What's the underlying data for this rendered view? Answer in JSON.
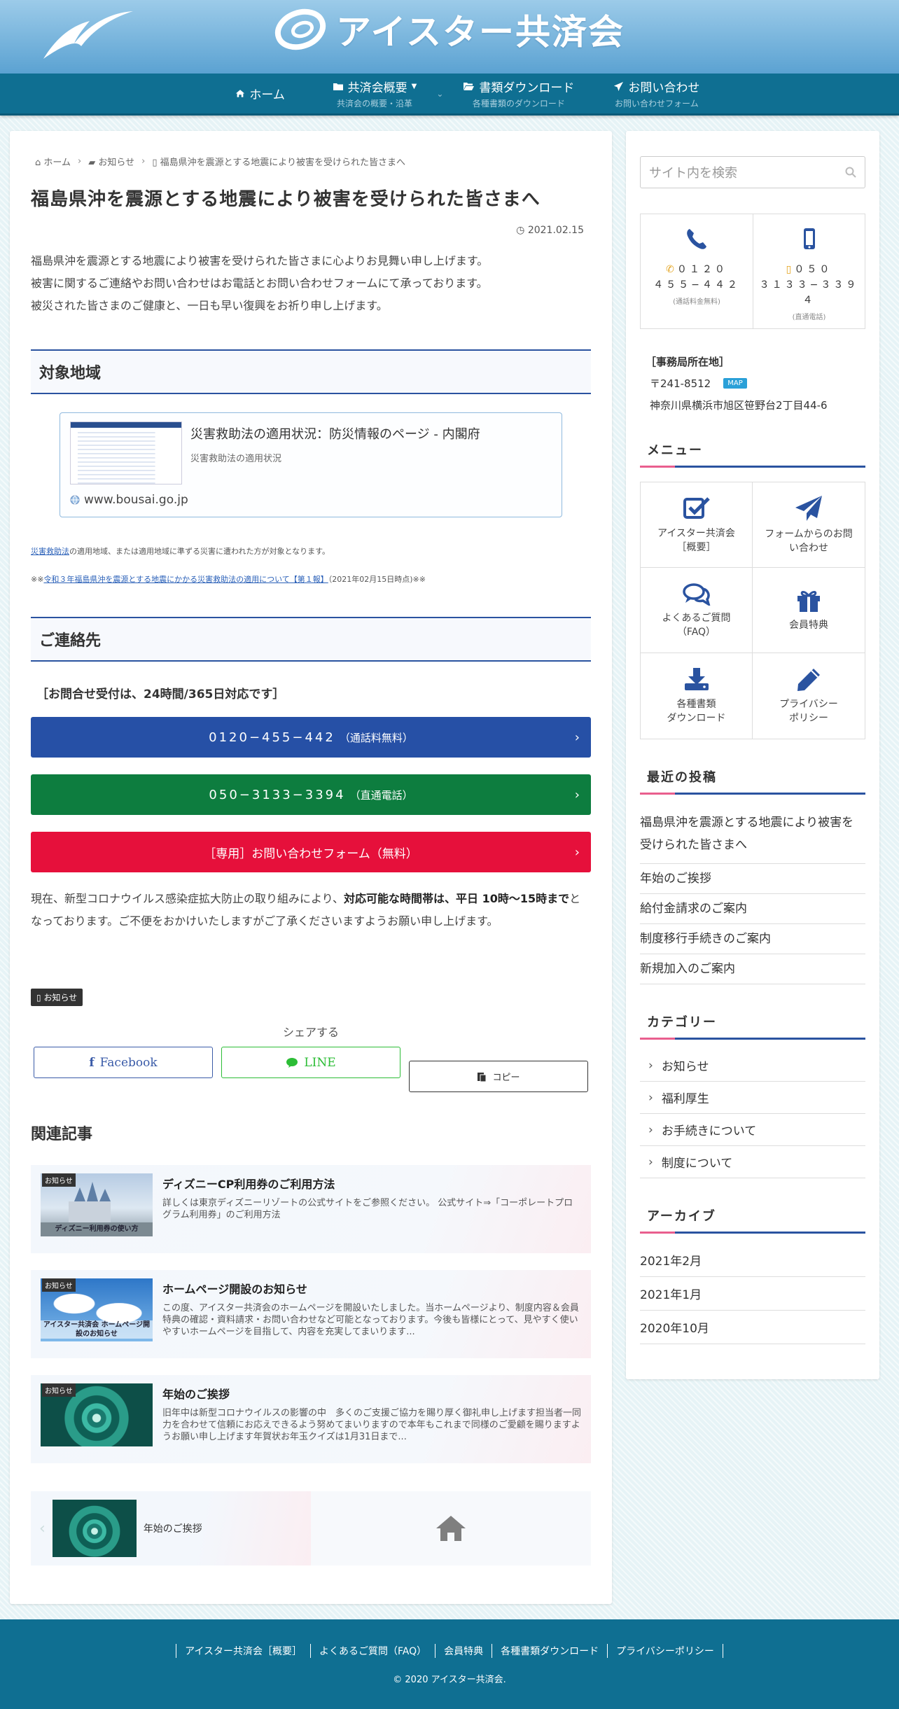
{
  "site": {
    "logo_text": "アイスター共済会"
  },
  "nav": [
    {
      "label": "ホーム",
      "sub": ""
    },
    {
      "label": "共済会概要",
      "sub": "共済会の概要・沿革"
    },
    {
      "label": "書類ダウンロード",
      "sub": "各種書類のダウンロード"
    },
    {
      "label": "お問い合わせ",
      "sub": "お問い合わせフォーム"
    }
  ],
  "breadcrumb": [
    "ホーム",
    "お知らせ",
    "福島県沖を震源とする地震により被害を受けられた皆さまへ"
  ],
  "article": {
    "title": "福島県沖を震源とする地震により被害を受けられた皆さまへ",
    "date": "2021.02.15",
    "intro": [
      "福島県沖を震源とする地震により被害を受けられた皆さまに心よりお見舞い申し上げます。",
      "被害に関するご連絡やお問い合わせはお電話とお問い合わせフォームにて承っております。",
      "被災された皆さまのご健康と、一日も早い復興をお祈り申し上げます。"
    ],
    "section1": "対象地域",
    "blogcard": {
      "title": "災害救助法の適用状況：防災情報のページ - 内閣府",
      "desc": "災害救助法の適用状況",
      "site": "www.bousai.go.jp"
    },
    "note1_link": "災害救助法",
    "note1_text": "の適用地域、または適用地域に準ずる災害に遭われた方が対象となります。",
    "note2_prefix": "※※",
    "note2_link": "令和３年福島県沖を震源とする地震にかかる災害救助法の適用について【第１報】",
    "note2_suffix": "（2021年02月15日時点)※※",
    "section2": "ご連絡先",
    "accept": "［お問合せ受付は、24時間/365日対応です］",
    "cta1_num": "0120−455−442",
    "cta1_note": "（通話料無料）",
    "cta2_num": "050−3133−3394",
    "cta2_note": "（直通電話）",
    "cta3": "［専用］お問い合わせフォーム（無料）",
    "covid_a": "現在、新型コロナウイルス感染症拡大防止の取り組みにより、",
    "covid_b": "対応可能な時間帯は、平日 10時〜15時まで",
    "covid_c": "となっております。ご不便をおかけいたしますがご了承くださいますようお願い申し上げます。",
    "tag": "お知らせ",
    "share_label": "シェアする",
    "share": [
      "Facebook",
      "LINE",
      "コピー"
    ],
    "related_heading": "関連記事",
    "related": [
      {
        "cat": "お知らせ",
        "caption": "ディズニー利用券の使い方",
        "title": "ディズニーCP利用券のご利用方法",
        "desc": "詳しくは東京ディズニーリゾートの公式サイトをご参照ください。 公式サイト⇒「コーポレートプログラム利用券」のご利用方法"
      },
      {
        "cat": "お知らせ",
        "caption": "アイスター共済会 ホームページ開設のお知らせ",
        "title": "ホームページ開設のお知らせ",
        "desc": "この度、アイスター共済会のホームページを開設いたしました。当ホームページより、制度内容＆会員特典の確認・資料請求・お問い合わせなど可能となっております。今後も皆様にとって、見やすく使いやすいホームページを目指して、内容を充実してまいります..."
      },
      {
        "cat": "お知らせ",
        "caption": "",
        "title": "年始のご挨拶",
        "desc": "旧年中は新型コロナウイルスの影響の中　多くのご支援ご協力を賜り厚く御礼申し上げます担当者一同力を合わせて信頼にお応えできるよう努めてまいりますので本年もこれまで同様のご愛顧を賜りますようお願い申し上げます年賀状お年玉クイズは1月31日まで..."
      }
    ],
    "prev_title": "年始のご挨拶"
  },
  "sidebar": {
    "search_placeholder": "サイト内を検索",
    "phone1_lines": [
      "０１２０",
      "４５５−４４２"
    ],
    "phone1_cap": "(通話料金無料)",
    "phone2_lines": [
      "０５０",
      "３１３３−３３９４"
    ],
    "phone2_cap": "(直通電話)",
    "office_heading": "［事務局所在地］",
    "postal": "〒241-8512",
    "map": "MAP",
    "address": "神奈川県横浜市旭区笹野台2丁目44-6",
    "menu_heading": "メニュー",
    "menu": [
      "アイスター共済会\n［概要］",
      "フォームからのお問\nい合わせ",
      "よくあるご質問\n（FAQ）",
      "会員特典",
      "各種書類\nダウンロード",
      "プライバシー\nポリシー"
    ],
    "recent_heading": "最近の投稿",
    "recent": [
      "福島県沖を震源とする地震により被害を受けられた皆さまへ",
      "年始のご挨拶",
      "給付金請求のご案内",
      "制度移行手続きのご案内",
      "新規加入のご案内"
    ],
    "category_heading": "カテゴリー",
    "categories": [
      "お知らせ",
      "福利厚生",
      "お手続きについて",
      "制度について"
    ],
    "archive_heading": "アーカイブ",
    "archives": [
      "2021年2月",
      "2021年1月",
      "2020年10月"
    ]
  },
  "footer": {
    "links": [
      "アイスター共済会［概要］",
      "よくあるご質問（FAQ）",
      "会員特典",
      "各種書類ダウンロード",
      "プライバシーポリシー"
    ],
    "copyright": "© 2020 アイスター共済会."
  },
  "colors": {
    "nav": "#0f6f92",
    "accent_blue": "#2a53a0",
    "cta_blue": "#2650a6",
    "cta_green": "#0d7d3f",
    "cta_red": "#e6103b"
  }
}
